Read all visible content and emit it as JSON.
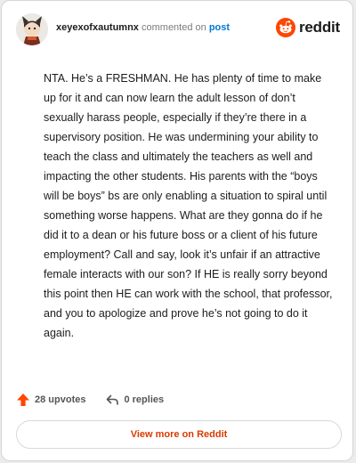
{
  "header": {
    "username": "xeyexofxautumnx",
    "action_text": "commented on",
    "post_link": "post",
    "brand": "reddit"
  },
  "comment": {
    "text": "NTA. He’s a FRESHMAN. He has plenty of time to make up for it and can now learn the adult lesson of don’t sexually harass people, especially if they’re there in a supervisory position. He was undermining your ability to teach the class and ultimately the teachers as well and impacting the other students. His parents with the “boys will be boys” bs are only enabling a situation to spiral until something worse happens. What are they gonna do if he did it to a dean or his future boss or a client of his future employment? Call and say, look it’s unfair if an attractive female interacts with our son? If HE is really sorry beyond this point then HE can work with the school, that professor, and you to apologize and prove he’s not going to do it again."
  },
  "stats": {
    "upvotes": "28 upvotes",
    "replies": "0 replies"
  },
  "footer": {
    "view_more_label": "View more on Reddit"
  },
  "colors": {
    "brand_orange": "#ff4500",
    "link_blue": "#0079d3",
    "view_more_text": "#d93a00"
  },
  "icons": {
    "upvote": "upvote-arrow-icon",
    "reply": "reply-arrow-icon",
    "brand": "reddit-snoo-icon"
  }
}
